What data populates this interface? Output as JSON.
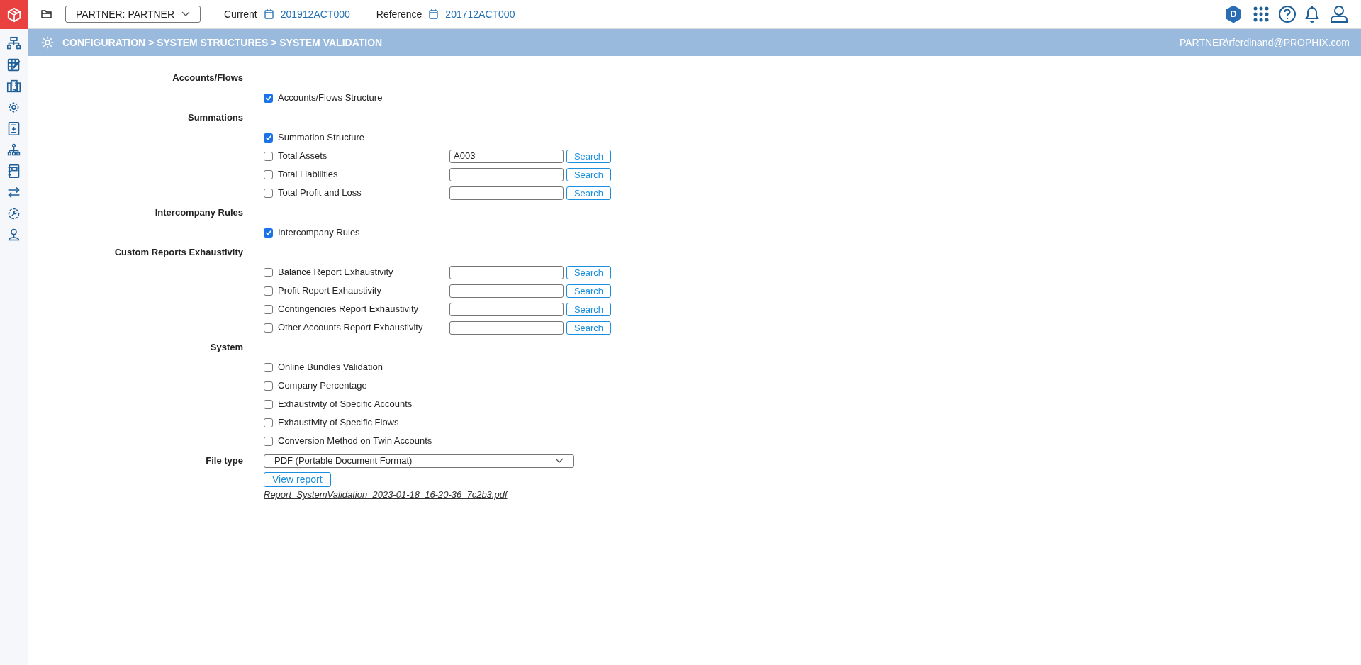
{
  "top_bar": {
    "partner_dropdown": "PARTNER: PARTNER",
    "current_label": "Current",
    "current_value": "201912ACT000",
    "reference_label": "Reference",
    "reference_value": "201712ACT000",
    "badge_letter": "D"
  },
  "header": {
    "breadcrumb": "CONFIGURATION > SYSTEM STRUCTURES > SYSTEM VALIDATION",
    "user": "PARTNER\\rferdinand@PROPHIX.com"
  },
  "sections": [
    {
      "label": "Accounts/Flows",
      "items": [
        {
          "kind": "check",
          "label": "Accounts/Flows Structure",
          "checked": true
        }
      ]
    },
    {
      "label": "Summations",
      "items": [
        {
          "kind": "check",
          "label": "Summation Structure",
          "checked": true
        },
        {
          "kind": "search",
          "label": "Total Assets",
          "checked": false,
          "value": "A003",
          "button": "Search"
        },
        {
          "kind": "search",
          "label": "Total Liabilities",
          "checked": false,
          "button": "Search"
        },
        {
          "kind": "search",
          "label": "Total Profit and Loss",
          "checked": false,
          "button": "Search"
        }
      ]
    },
    {
      "label": "Intercompany Rules",
      "items": [
        {
          "kind": "check",
          "label": "Intercompany Rules",
          "checked": true
        }
      ]
    },
    {
      "label": "Custom Reports Exhaustivity",
      "items": [
        {
          "kind": "search",
          "label": "Balance Report Exhaustivity",
          "checked": false,
          "button": "Search"
        },
        {
          "kind": "search",
          "label": "Profit Report Exhaustivity",
          "checked": false,
          "button": "Search"
        },
        {
          "kind": "search",
          "label": "Contingencies Report Exhaustivity",
          "checked": false,
          "button": "Search"
        },
        {
          "kind": "search",
          "label": "Other Accounts Report Exhaustivity",
          "checked": false,
          "button": "Search"
        }
      ]
    },
    {
      "label": "System",
      "items": [
        {
          "kind": "check",
          "label": "Online Bundles Validation",
          "checked": false
        },
        {
          "kind": "check",
          "label": "Company Percentage",
          "checked": false
        },
        {
          "kind": "check",
          "label": "Exhaustivity of Specific Accounts",
          "checked": false
        },
        {
          "kind": "check",
          "label": "Exhaustivity of Specific Flows",
          "checked": false
        },
        {
          "kind": "check",
          "label": "Conversion Method on Twin Accounts",
          "checked": false
        }
      ]
    }
  ],
  "file_type": {
    "label": "File type",
    "value": "PDF (Portable Document Format)"
  },
  "view_report_button": "View report",
  "report_link": "Report_SystemValidation_2023-01-18_16-20-36_7c2b3.pdf"
}
